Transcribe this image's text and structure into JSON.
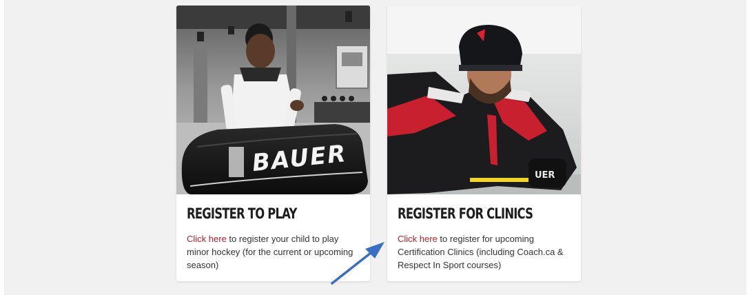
{
  "cards": [
    {
      "title": "REGISTER TO PLAY",
      "link_text": "Click here",
      "body_text": " to register your child to play minor hockey (for the current or upcoming season)",
      "image_label": "BAUER"
    },
    {
      "title": "REGISTER FOR CLINICS",
      "link_text": "Click here",
      "body_text": " to register for upcoming Certification Clinics (including Coach.ca & Respect In Sport courses)"
    }
  ],
  "colors": {
    "link": "#b3202a",
    "page_background": "#f1f1f1",
    "arrow": "#3a6dc4"
  }
}
